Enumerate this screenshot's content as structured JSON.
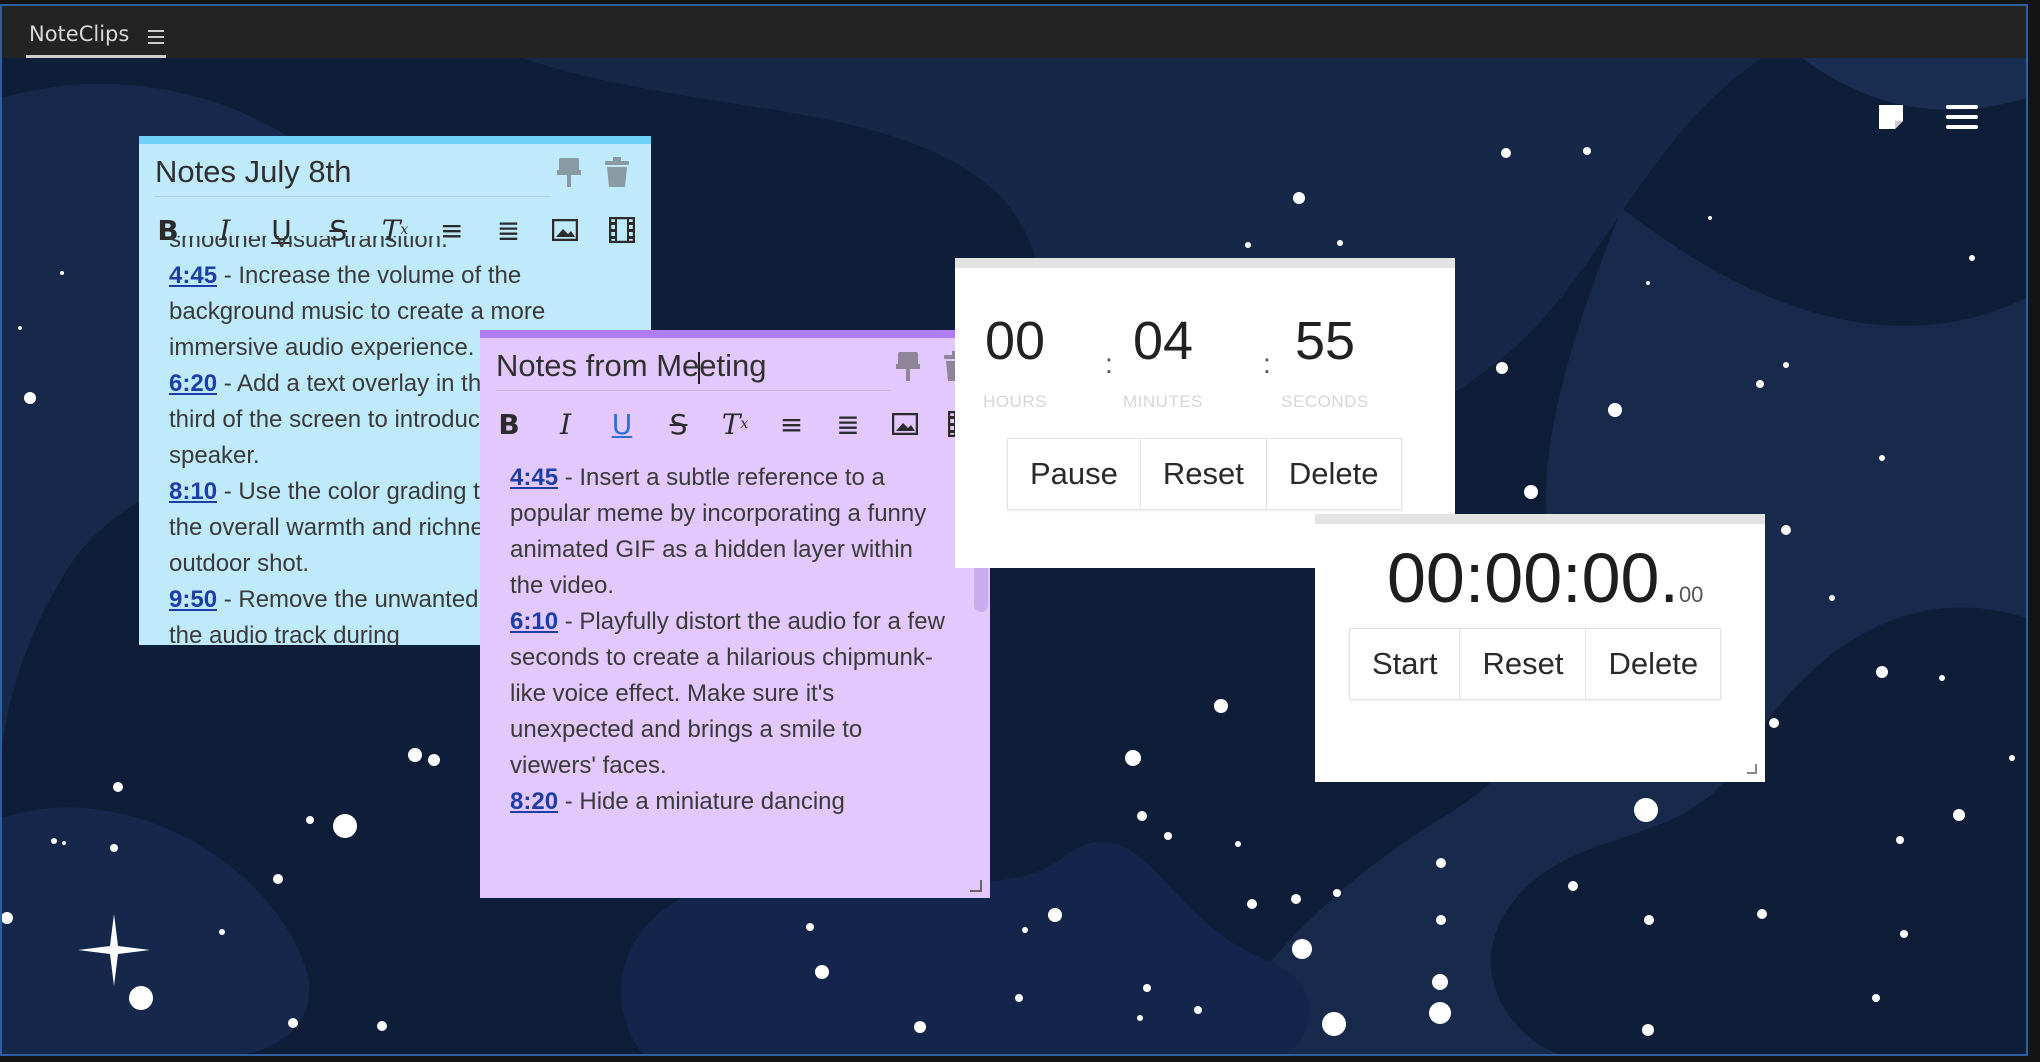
{
  "app": {
    "tab_label": "NoteClips",
    "tab_menu_icon": "hamburger-icon"
  },
  "toolbar_icons": [
    "bold-icon",
    "italic-icon",
    "underline-icon",
    "strikethrough-icon",
    "clear-format-icon",
    "bullet-list-icon",
    "numbered-list-icon",
    "image-icon",
    "video-icon"
  ],
  "notes": [
    {
      "title": "Notes July 8th",
      "color": "#bfeafb",
      "accent": "#6fd1f5",
      "entries": [
        {
          "time": "",
          "text": "smoother visual transition."
        },
        {
          "time": "4:45",
          "text": " - Increase the volume of the background music to create a more immersive audio experience."
        },
        {
          "time": "6:20",
          "text": " - Add a text overlay in the bottom third of the screen to introduce the speaker."
        },
        {
          "time": "8:10",
          "text": " - Use the color grading to enhance the overall warmth and richness of this outdoor shot."
        },
        {
          "time": "9:50",
          "text": " - Remove the unwanted noise from the audio track during"
        }
      ]
    },
    {
      "title_before_cursor": "Notes from Me",
      "title_after_cursor": "eting",
      "color": "#e2c8fd",
      "accent": "#b07cf4",
      "entries": [
        {
          "time": "4:45",
          "text": " - Insert a subtle reference to a popular meme by incorporating a funny animated GIF as a hidden layer within the video."
        },
        {
          "time": "6:10",
          "text": " - Playfully distort the audio for a few seconds to create a hilarious chipmunk-like voice effect. Make sure it's unexpected and brings a smile to viewers' faces."
        },
        {
          "time": "8:20",
          "text": " - Hide a miniature dancing"
        }
      ]
    }
  ],
  "timer": {
    "hours": "00",
    "minutes": "04",
    "seconds": "55",
    "hours_label": "HOURS",
    "minutes_label": "MINUTES",
    "seconds_label": "SECONDS",
    "colon": ":",
    "buttons": [
      "Pause",
      "Reset",
      "Delete"
    ]
  },
  "stopwatch": {
    "time": "00:00:00.",
    "ms": "00",
    "buttons": [
      "Start",
      "Reset",
      "Delete"
    ]
  }
}
